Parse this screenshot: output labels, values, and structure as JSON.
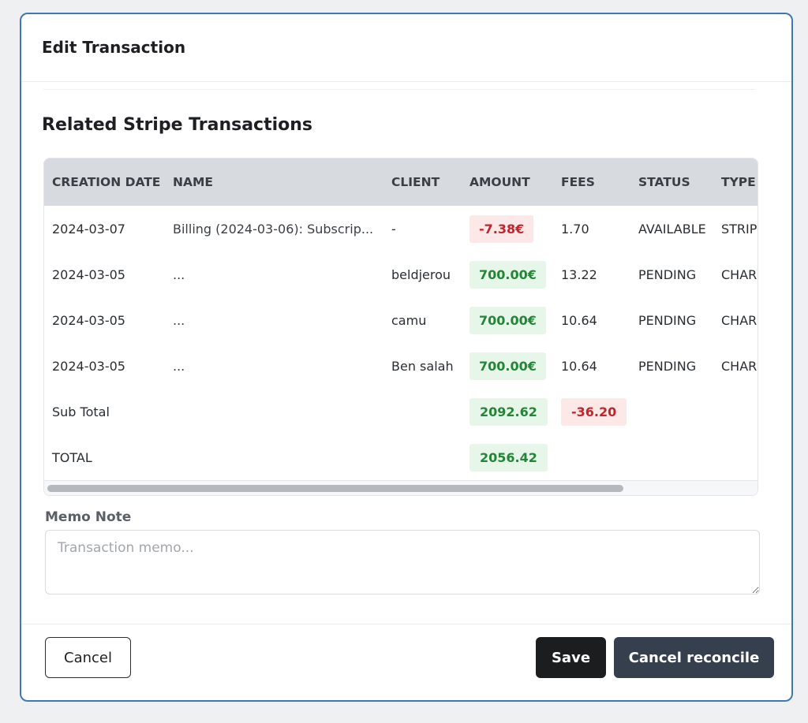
{
  "modal": {
    "title": "Edit Transaction",
    "section_title": "Related Stripe Transactions"
  },
  "table": {
    "columns": [
      "CREATION DATE",
      "NAME",
      "CLIENT",
      "AMOUNT",
      "FEES",
      "STATUS",
      "TYPE"
    ],
    "rows": [
      {
        "date": "2024-03-07",
        "name": "Billing (2024-03-06): Subscrip...",
        "client": "-",
        "amount": "-7.38€",
        "amount_sign": "negative",
        "fees": "1.70",
        "status": "AVAILABLE",
        "type": "STRIP"
      },
      {
        "date": "2024-03-05",
        "name": "...",
        "client": "beldjerou",
        "amount": "700.00€",
        "amount_sign": "positive",
        "fees": "13.22",
        "status": "PENDING",
        "type": "CHAR"
      },
      {
        "date": "2024-03-05",
        "name": "...",
        "client": "camu",
        "amount": "700.00€",
        "amount_sign": "positive",
        "fees": "10.64",
        "status": "PENDING",
        "type": "CHAR"
      },
      {
        "date": "2024-03-05",
        "name": "...",
        "client": "Ben salah",
        "amount": "700.00€",
        "amount_sign": "positive",
        "fees": "10.64",
        "status": "PENDING",
        "type": "CHAR"
      }
    ],
    "subtotal": {
      "label": "Sub Total",
      "amount": "2092.62",
      "fees": "-36.20"
    },
    "total": {
      "label": "TOTAL",
      "amount": "2056.42"
    }
  },
  "memo": {
    "label": "Memo Note",
    "placeholder": "Transaction memo...",
    "value": ""
  },
  "buttons": {
    "cancel": "Cancel",
    "save": "Save",
    "cancel_reconcile": "Cancel reconcile"
  },
  "colors": {
    "modal_border": "#3f78b4",
    "header_bg": "#d7dadf",
    "negative_text": "#c0262d",
    "negative_bg": "#fde8e8",
    "positive_text": "#238636",
    "positive_bg": "#e6f7e9",
    "save_bg": "#1c1d1f",
    "cancel_reconcile_bg": "#363f4d"
  }
}
